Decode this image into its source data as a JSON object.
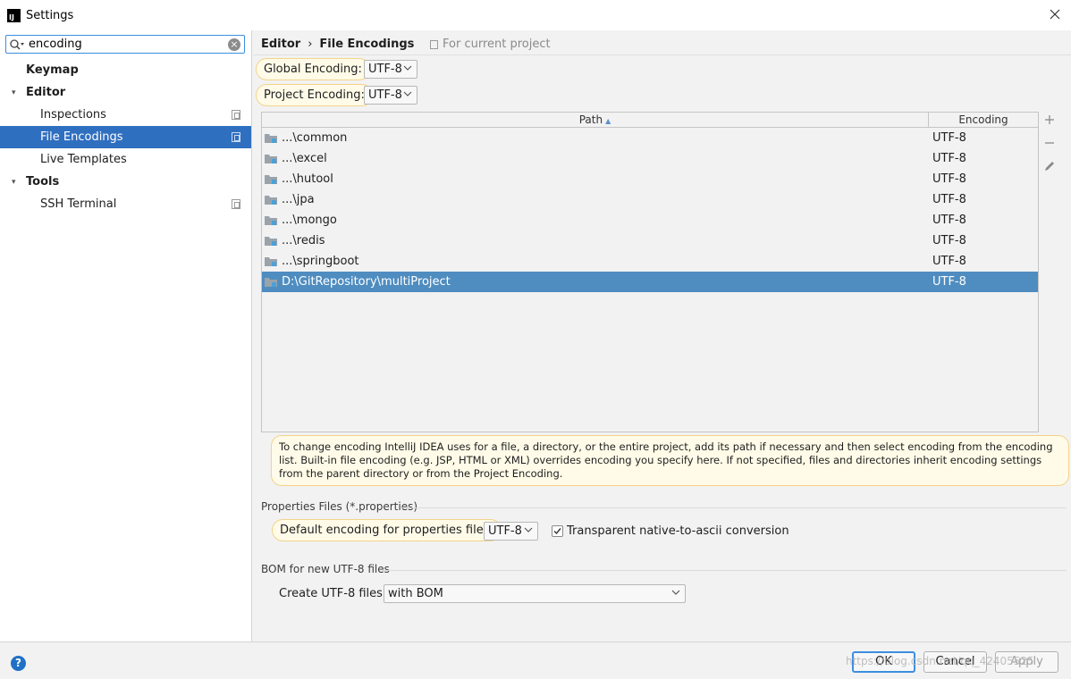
{
  "window": {
    "title": "Settings",
    "close_icon": "close-icon"
  },
  "sidebar": {
    "search": {
      "value": "encoding",
      "placeholder": ""
    },
    "items": [
      {
        "label": "Keymap",
        "bold": true
      },
      {
        "label": "Editor",
        "bold": true,
        "expanded": true
      },
      {
        "label": "Inspections"
      },
      {
        "label": "File Encodings",
        "selected": true
      },
      {
        "label": "Live Templates"
      },
      {
        "label": "Tools",
        "bold": true,
        "expanded": true
      },
      {
        "label": "SSH Terminal"
      }
    ]
  },
  "header": {
    "breadcrumb": [
      "Editor",
      "File Encodings"
    ],
    "separator": "›",
    "scope_note": "For current project"
  },
  "encodings": {
    "global_label": "Global Encoding:",
    "global_value": "UTF-8",
    "project_label": "Project Encoding:",
    "project_value": "UTF-8"
  },
  "table": {
    "columns": [
      "Path",
      "Encoding"
    ],
    "sort_indicator": "▲",
    "rows": [
      {
        "path": "...\\common",
        "encoding": "UTF-8"
      },
      {
        "path": "...\\excel",
        "encoding": "UTF-8"
      },
      {
        "path": "...\\hutool",
        "encoding": "UTF-8"
      },
      {
        "path": "...\\jpa",
        "encoding": "UTF-8"
      },
      {
        "path": "...\\mongo",
        "encoding": "UTF-8"
      },
      {
        "path": "...\\redis",
        "encoding": "UTF-8"
      },
      {
        "path": "...\\springboot",
        "encoding": "UTF-8"
      },
      {
        "path": "D:\\GitRepository\\multiProject",
        "encoding": "UTF-8",
        "selected": true
      }
    ],
    "tools": [
      "add-icon",
      "remove-icon",
      "edit-icon"
    ]
  },
  "info_text": "To change encoding IntelliJ IDEA uses for a file, a directory, or the entire project, add its path if necessary and then select encoding from the encoding list. Built-in file encoding (e.g. JSP, HTML or XML) overrides encoding you specify here. If not specified, files and directories inherit encoding settings from the parent directory or from the Project Encoding.",
  "properties": {
    "section_title": "Properties Files (*.properties)",
    "default_label": "Default encoding for properties files:",
    "default_value": "UTF-8",
    "transparent_label": "Transparent native-to-ascii conversion",
    "transparent_checked": true
  },
  "bom": {
    "section_title": "BOM for new UTF-8 files",
    "create_label": "Create UTF-8 files:",
    "create_value": "with BOM"
  },
  "footer": {
    "help": "?",
    "ok": "OK",
    "cancel": "Cancel",
    "apply": "Apply",
    "watermark": "https://blog.csdn.net/qq_42405525"
  },
  "colors": {
    "selection": "#2f6fc0",
    "table_selection": "#4f8dc0",
    "highlight_bg": "#fffbe8",
    "highlight_border": "#f3d38a",
    "accent": "#3c8ee0"
  }
}
